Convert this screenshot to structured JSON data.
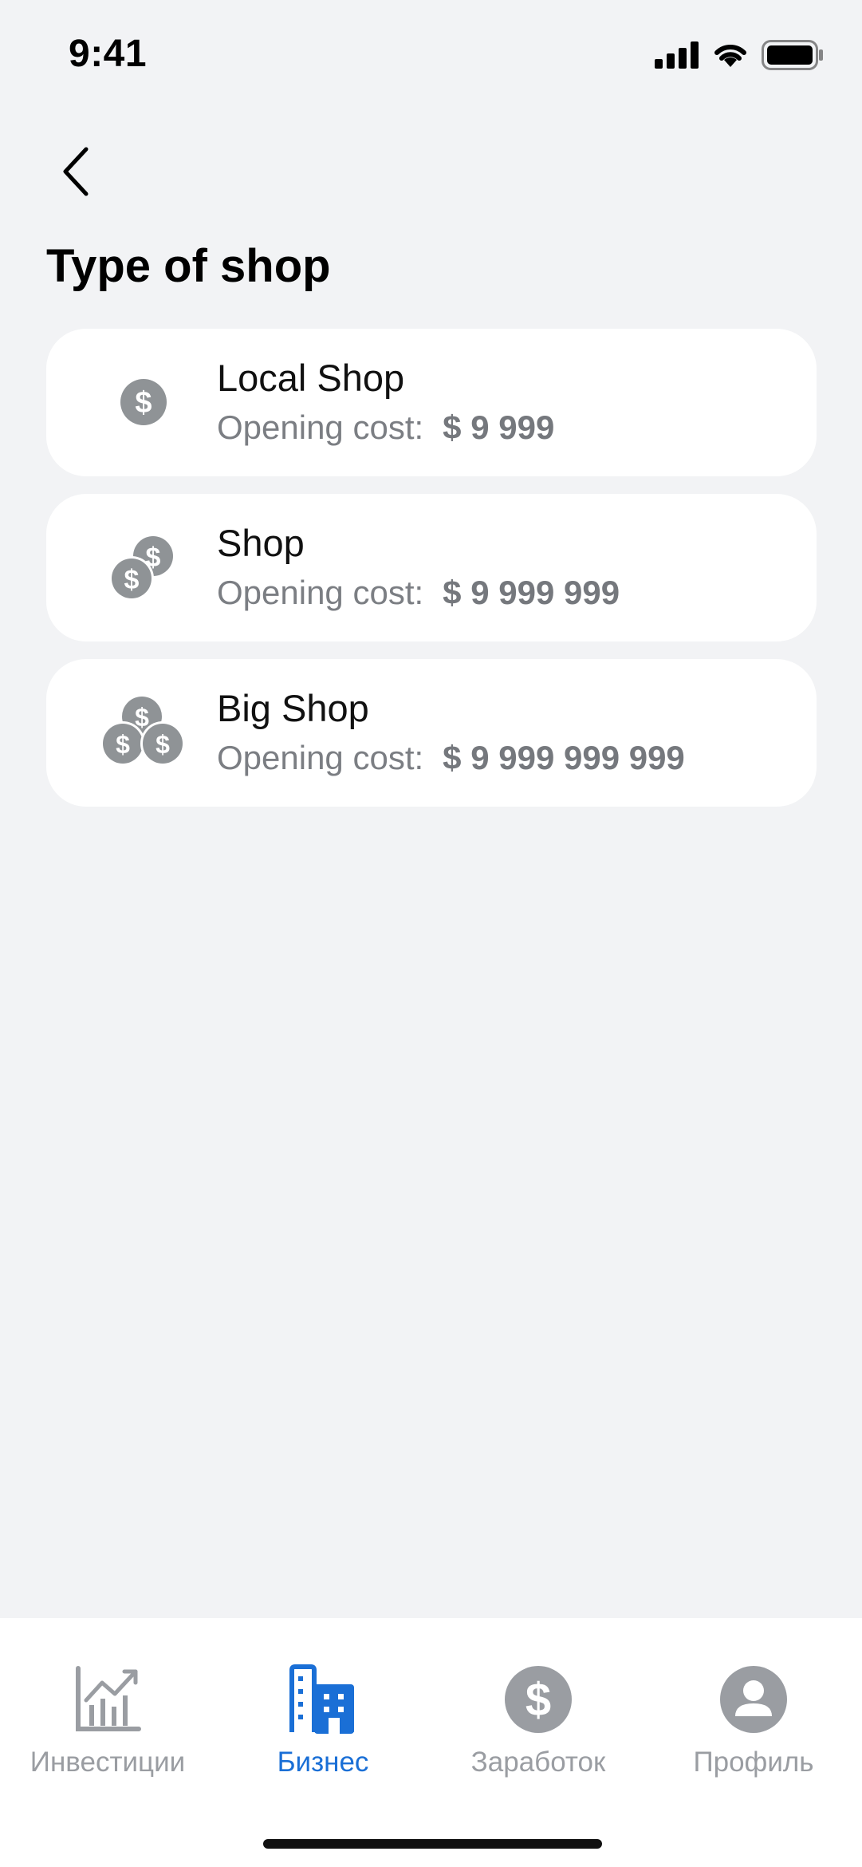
{
  "status": {
    "time": "9:41",
    "icons": [
      "cellular-signal-icon",
      "wifi-icon",
      "battery-icon"
    ]
  },
  "header": {
    "back_icon": "chevron-left-icon",
    "title": "Type of shop"
  },
  "shops": [
    {
      "icon": "single-coin-icon",
      "name": "Local Shop",
      "cost_label": "Opening cost:",
      "cost_value": "$ 9 999"
    },
    {
      "icon": "two-coins-icon",
      "name": "Shop",
      "cost_label": "Opening cost:",
      "cost_value": "$ 9 999 999"
    },
    {
      "icon": "three-coins-icon",
      "name": "Big Shop",
      "cost_label": "Opening cost:",
      "cost_value": "$ 9 999 999 999"
    }
  ],
  "tabs": [
    {
      "icon": "investments-chart-icon",
      "label": "Инвестиции",
      "active": false
    },
    {
      "icon": "business-building-icon",
      "label": "Бизнес",
      "active": true
    },
    {
      "icon": "earnings-dollar-icon",
      "label": "Заработок",
      "active": false
    },
    {
      "icon": "profile-user-icon",
      "label": "Профиль",
      "active": false
    }
  ],
  "colors": {
    "background": "#f2f3f5",
    "card": "#ffffff",
    "accent": "#1a6fd6",
    "muted": "#9a9da2",
    "coin": "#8f9396"
  }
}
